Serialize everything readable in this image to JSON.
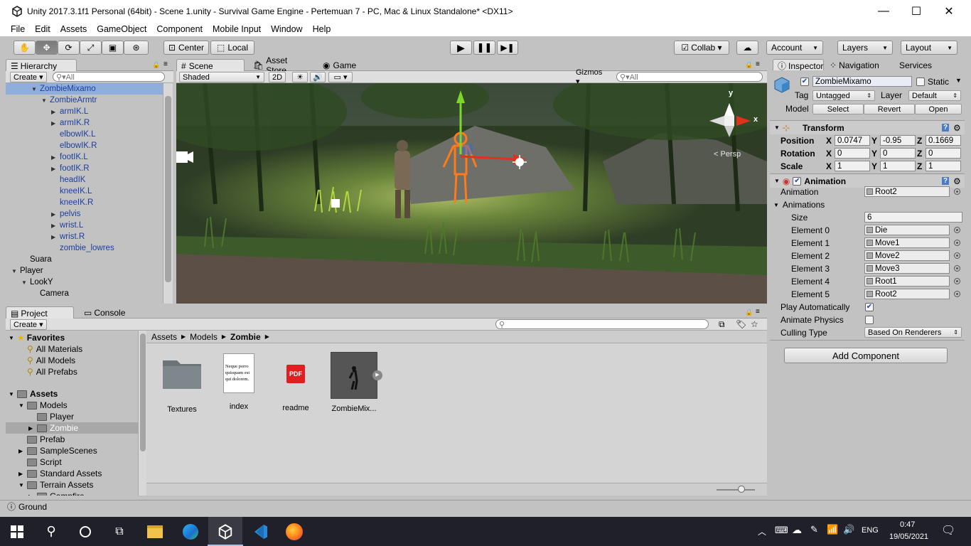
{
  "window": {
    "title": "Unity 2017.3.1f1 Personal (64bit) - Scene 1.unity - Survival Game Engine - Pertemuan 7 - PC, Mac & Linux Standalone* <DX11>",
    "minimize": "—",
    "maximize": "☐",
    "close": "✕"
  },
  "menu": [
    "File",
    "Edit",
    "Assets",
    "GameObject",
    "Component",
    "Mobile Input",
    "Window",
    "Help"
  ],
  "toolbar": {
    "tools": [
      "hand-tool-icon",
      "move-tool-icon",
      "rotate-tool-icon",
      "scale-tool-icon",
      "rect-tool-icon",
      "transform-tool-icon"
    ],
    "pivot_label": "Center",
    "space_label": "Local",
    "collab_label": "Collab ▾",
    "account_label": "Account",
    "layers_label": "Layers",
    "layout_label": "Layout"
  },
  "hierarchy": {
    "tab_label": "Hierarchy",
    "create_label": "Create ▾",
    "search_placeholder": "▾All",
    "items": [
      {
        "label": "ZombieMixamo",
        "depth": 2,
        "arrow": "open",
        "blue": true,
        "selected": true
      },
      {
        "label": "ZombieArmtr",
        "depth": 3,
        "arrow": "open",
        "blue": true
      },
      {
        "label": "armIK.L",
        "depth": 4,
        "arrow": "closed",
        "blue": true
      },
      {
        "label": "armIK.R",
        "depth": 4,
        "arrow": "closed",
        "blue": true
      },
      {
        "label": "elbowIK.L",
        "depth": 4,
        "arrow": "none",
        "blue": true
      },
      {
        "label": "elbowIK.R",
        "depth": 4,
        "arrow": "none",
        "blue": true
      },
      {
        "label": "footIK.L",
        "depth": 4,
        "arrow": "closed",
        "blue": true
      },
      {
        "label": "footIK.R",
        "depth": 4,
        "arrow": "closed",
        "blue": true
      },
      {
        "label": "headIK",
        "depth": 4,
        "arrow": "none",
        "blue": true
      },
      {
        "label": "kneeIK.L",
        "depth": 4,
        "arrow": "none",
        "blue": true
      },
      {
        "label": "kneeIK.R",
        "depth": 4,
        "arrow": "none",
        "blue": true
      },
      {
        "label": "pelvis",
        "depth": 4,
        "arrow": "closed",
        "blue": true
      },
      {
        "label": "wrist.L",
        "depth": 4,
        "arrow": "closed",
        "blue": true
      },
      {
        "label": "wrist.R",
        "depth": 4,
        "arrow": "closed",
        "blue": true
      },
      {
        "label": "zombie_lowres",
        "depth": 4,
        "arrow": "none",
        "blue": true
      },
      {
        "label": "Suara",
        "depth": 1,
        "arrow": "none",
        "blue": false
      },
      {
        "label": "Player",
        "depth": 0,
        "arrow": "open",
        "blue": false
      },
      {
        "label": "LookY",
        "depth": 1,
        "arrow": "open",
        "blue": false
      },
      {
        "label": "Camera",
        "depth": 2,
        "arrow": "none",
        "blue": false
      }
    ]
  },
  "scene": {
    "tabs": [
      "Scene",
      "Asset Store",
      "Game"
    ],
    "shading_label": "Shaded",
    "twod_label": "2D",
    "gizmos_label": "Gizmos ▾",
    "search_placeholder": "▾All",
    "persp_label": "< Persp",
    "gizmo_y": "y",
    "gizmo_x": "x"
  },
  "inspector": {
    "tabs": [
      "Inspector",
      "Navigation",
      "Services"
    ],
    "object_name": "ZombieMixamo",
    "static_label": "Static",
    "tag_label": "Tag",
    "tag_value": "Untagged",
    "layer_label": "Layer",
    "layer_value": "Default",
    "model_label": "Model",
    "model_buttons": [
      "Select",
      "Revert",
      "Open"
    ],
    "transform": {
      "title": "Transform",
      "position_label": "Position",
      "rotation_label": "Rotation",
      "scale_label": "Scale",
      "position": [
        "0.0747",
        "-0.95",
        "0.1669"
      ],
      "rotation": [
        "0",
        "0",
        "0"
      ],
      "scale": [
        "1",
        "1",
        "1"
      ],
      "axes": [
        "X",
        "Y",
        "Z"
      ]
    },
    "animation": {
      "title": "Animation",
      "animation_label": "Animation",
      "animation_value": "Root2",
      "animations_label": "Animations",
      "size_label": "Size",
      "size_value": "6",
      "elements": [
        {
          "label": "Element 0",
          "value": "Die"
        },
        {
          "label": "Element 1",
          "value": "Move1"
        },
        {
          "label": "Element 2",
          "value": "Move2"
        },
        {
          "label": "Element 3",
          "value": "Move3"
        },
        {
          "label": "Element 4",
          "value": "Root1"
        },
        {
          "label": "Element 5",
          "value": "Root2"
        }
      ],
      "play_auto_label": "Play Automatically",
      "play_auto_checked": true,
      "animate_physics_label": "Animate Physics",
      "animate_physics_checked": false,
      "culling_label": "Culling Type",
      "culling_value": "Based On Renderers"
    },
    "add_component_label": "Add Component"
  },
  "project": {
    "tabs": [
      "Project",
      "Console"
    ],
    "create_label": "Create ▾",
    "favorites_label": "Favorites",
    "favorites": [
      "All Materials",
      "All Models",
      "All Prefabs"
    ],
    "assets_label": "Assets",
    "tree": [
      {
        "label": "Models",
        "depth": 1,
        "arrow": "open"
      },
      {
        "label": "Player",
        "depth": 2,
        "arrow": "none"
      },
      {
        "label": "Zombie",
        "depth": 2,
        "arrow": "closed",
        "selected": true
      },
      {
        "label": "Prefab",
        "depth": 1,
        "arrow": "none"
      },
      {
        "label": "SampleScenes",
        "depth": 1,
        "arrow": "closed"
      },
      {
        "label": "Script",
        "depth": 1,
        "arrow": "none"
      },
      {
        "label": "Standard Assets",
        "depth": 1,
        "arrow": "closed"
      },
      {
        "label": "Terrain Assets",
        "depth": 1,
        "arrow": "open"
      },
      {
        "label": "Campfire",
        "depth": 2,
        "arrow": "closed"
      }
    ],
    "breadcrumb": [
      "Assets",
      "Models",
      "Zombie"
    ],
    "assets": [
      {
        "label": "Textures",
        "kind": "folder"
      },
      {
        "label": "index",
        "kind": "doc",
        "preview_text": "Neque porro quisquam est qui dolorem."
      },
      {
        "label": "readme",
        "kind": "pdf",
        "badge": "PDF"
      },
      {
        "label": "ZombieMix...",
        "kind": "model"
      }
    ]
  },
  "status": {
    "text": "Ground"
  },
  "taskbar": {
    "time": "0:47",
    "date": "19/05/2021",
    "lang": "ENG",
    "apps": [
      "windows-start-icon",
      "search-icon",
      "cortana-icon",
      "task-view-icon",
      "file-explorer-icon",
      "edge-icon",
      "unity-icon",
      "vscode-icon",
      "firefox-icon"
    ]
  }
}
